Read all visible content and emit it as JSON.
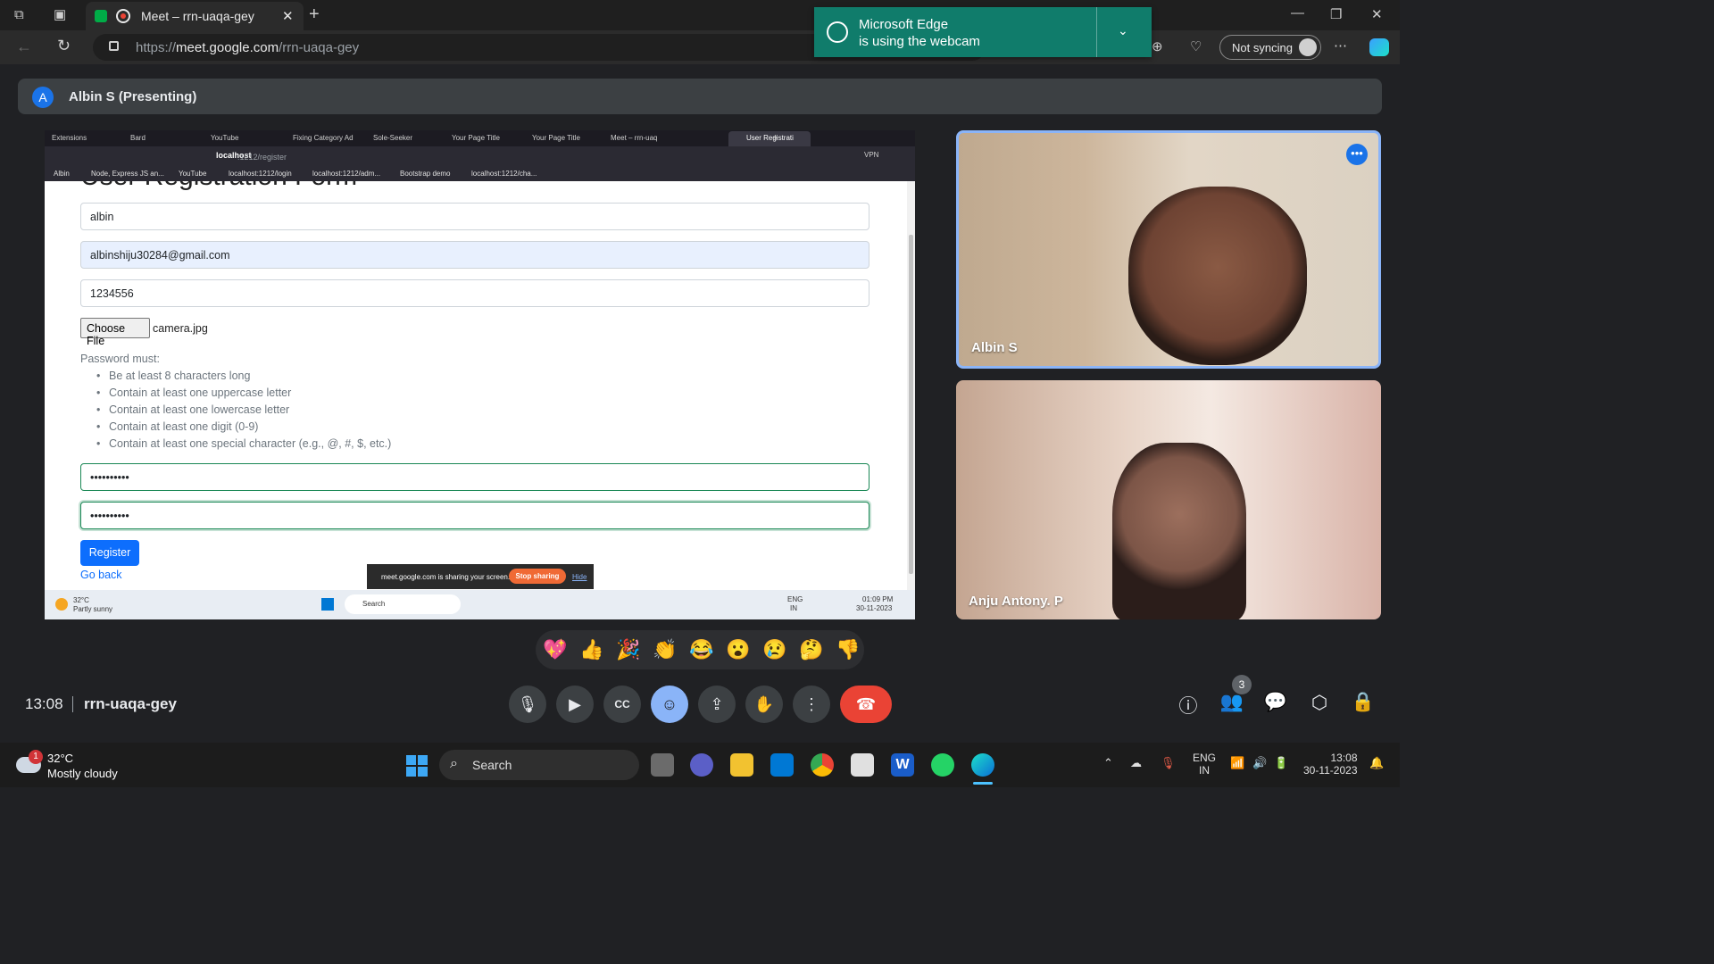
{
  "browser": {
    "tab_title": "Meet – rrn-uaqa-gey",
    "url_prefix": "https://",
    "url_host": "meet.google.com",
    "url_path": "/rrn-uaqa-gey",
    "not_syncing": "Not syncing",
    "webcam_notice_line1": "Microsoft Edge",
    "webcam_notice_line2": "is using the webcam"
  },
  "meet": {
    "presenter_initial": "A",
    "presenter_label": "Albin S (Presenting)",
    "time": "13:08",
    "meeting_code": "rrn-uaqa-gey",
    "people_count": "3",
    "participants": [
      {
        "name": "Albin S"
      },
      {
        "name": "Anju Antony. P"
      }
    ],
    "reactions": [
      "💖",
      "👍",
      "🎉",
      "👏",
      "😂",
      "😮",
      "😢",
      "🤔",
      "👎"
    ]
  },
  "shared_screen": {
    "tabs": [
      "Extensions",
      "Bard",
      "YouTube",
      "Fixing Category Ad",
      "Sole-Seeker",
      "Your Page Title",
      "Your Page Title",
      "Meet – rrn-uaq",
      "User Registrati"
    ],
    "url_host": "localhost",
    "url_path": ":1212/register",
    "vpn": "VPN",
    "bookmarks": [
      "Albin",
      "Node, Express JS an...",
      "YouTube",
      "localhost:1212/login",
      "localhost:1212/adm...",
      "Bootstrap demo",
      "localhost:1212/cha..."
    ],
    "form": {
      "heading": "User Registration Form",
      "name_value": "albin",
      "email_value": "albinshiju30284@gmail.com",
      "phone_value": "1234556",
      "choose_file": "Choose File",
      "file_name": "camera.jpg",
      "password_must": "Password must:",
      "rules": [
        "Be at least 8 characters long",
        "Contain at least one uppercase letter",
        "Contain at least one lowercase letter",
        "Contain at least one digit (0-9)",
        "Contain at least one special character (e.g., @, #, $, etc.)"
      ],
      "password_value": "••••••••••",
      "confirm_value": "••••••••••",
      "register": "Register",
      "go_back": "Go back"
    },
    "share_bar": {
      "text": "meet.google.com is sharing your screen.",
      "stop": "Stop sharing",
      "hide": "Hide"
    },
    "taskbar": {
      "temp": "32°C",
      "weather": "Partly sunny",
      "search": "Search",
      "lang1": "ENG",
      "lang2": "IN",
      "time": "01:09 PM",
      "date": "30-11-2023"
    }
  },
  "taskbar": {
    "weather_badge": "1",
    "temp": "32°C",
    "weather": "Mostly cloudy",
    "search": "Search",
    "lang1": "ENG",
    "lang2": "IN",
    "time": "13:08",
    "date": "30-11-2023"
  }
}
